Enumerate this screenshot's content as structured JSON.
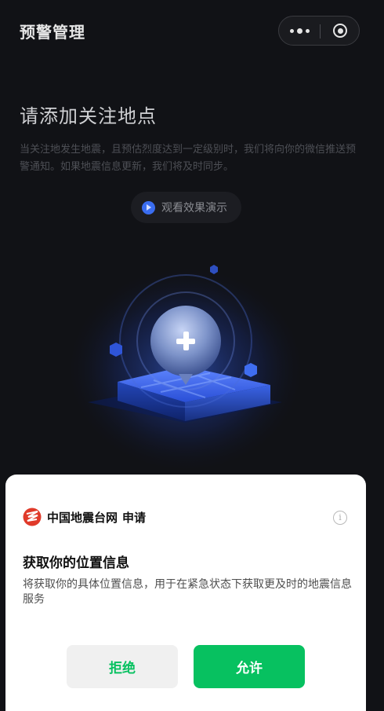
{
  "nav": {
    "title": "预警管理",
    "more_icon": "more-dots-icon",
    "close_icon": "capsule-close-icon"
  },
  "main": {
    "headline": "请添加关注地点",
    "description": "当关注地发生地震，且预估烈度达到一定级别时，我们将向你的微信推送预警通知。如果地震信息更新，我们将及时同步。",
    "demo_button": "观看效果演示",
    "demo_icon": "play-icon",
    "illustration_icon": "add-location-icon"
  },
  "sheet": {
    "app_name": "中国地震台网",
    "app_action": "申请",
    "info_symbol": "i",
    "title": "获取你的位置信息",
    "description": "将获取你的具体位置信息，用于在紧急状态下获取更及时的地震信息服务",
    "deny_label": "拒绝",
    "allow_label": "允许"
  },
  "colors": {
    "accent_green": "#07c160",
    "background_dark": "#111216",
    "illustration_blue": "#2b5fe0"
  }
}
